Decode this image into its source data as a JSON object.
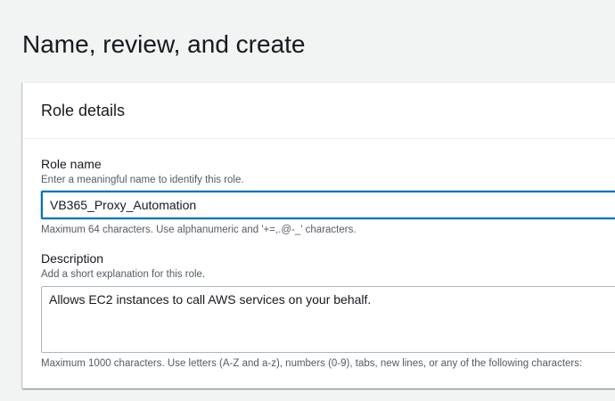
{
  "page": {
    "title": "Name, review, and create"
  },
  "role_details": {
    "title": "Role details",
    "role_name": {
      "label": "Role name",
      "hint": "Enter a meaningful name to identify this role.",
      "value": "VB365_Proxy_Automation",
      "constraint": "Maximum 64 characters. Use alphanumeric and '+=,.@-_' characters."
    },
    "description": {
      "label": "Description",
      "hint": "Add a short explanation for this role.",
      "value": "Allows EC2 instances to call AWS services on your behalf.",
      "constraint": "Maximum 1000 characters. Use letters (A-Z and a-z), numbers (0-9), tabs, new lines, or any of the following characters:"
    }
  },
  "colors": {
    "focus_border": "#0073bb",
    "input_border": "#aab7b8",
    "page_background": "#f2f3f3",
    "hint_text": "#545b64"
  }
}
